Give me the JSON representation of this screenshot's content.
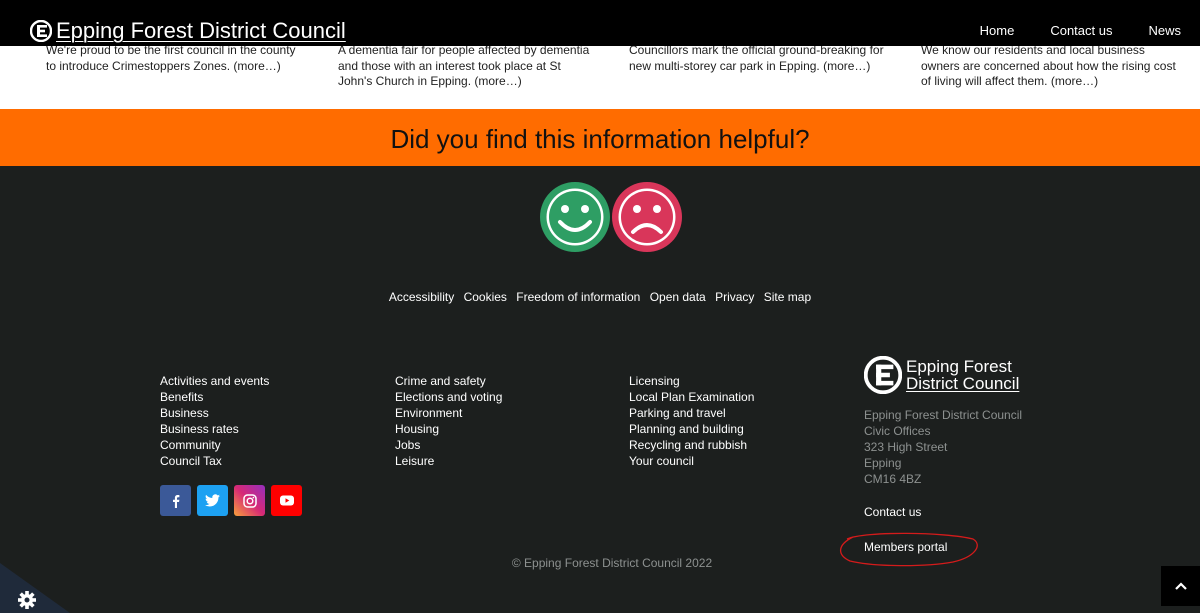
{
  "header": {
    "site_name": "Epping Forest District Council",
    "nav": [
      "Home",
      "Contact us",
      "News"
    ]
  },
  "news": [
    {
      "line0": "We're proud to be the first council in the county",
      "text": "to introduce Crimestoppers Zones. (more…)"
    },
    {
      "line0": "A dementia fair for people affected by dementia",
      "text": "and those with an interest took place at St",
      "text2": "John's Church in Epping. (more…)"
    },
    {
      "line0": "Councillors mark the official ground-breaking for",
      "text": "new multi-storey car park in Epping. (more…)"
    },
    {
      "line0": "We know our residents and local business",
      "text": "owners are concerned about how the rising cost",
      "text2": "of living will affect them. (more…)"
    }
  ],
  "feedback": {
    "question": "Did you find this information helpful?",
    "yes_color": "#2e9e64",
    "no_color": "#d9365a"
  },
  "footer_links": [
    "Accessibility",
    "Cookies",
    "Freedom of information",
    "Open data",
    "Privacy",
    "Site map"
  ],
  "columns": [
    [
      "Activities and events",
      "Benefits",
      "Business",
      "Business rates",
      "Community",
      "Council Tax"
    ],
    [
      "Crime and safety",
      "Elections and voting",
      "Environment",
      "Housing",
      "Jobs",
      "Leisure"
    ],
    [
      "Licensing",
      "Local Plan Examination",
      "Parking and travel",
      "Planning and building",
      "Recycling and rubbish",
      "Your council"
    ]
  ],
  "social": [
    {
      "name": "facebook",
      "glyph": "f",
      "color": "#3b5998"
    },
    {
      "name": "twitter",
      "glyph": "t",
      "color": "#1da1f2"
    },
    {
      "name": "instagram",
      "glyph": "◎",
      "color": "#c13584"
    },
    {
      "name": "youtube",
      "glyph": "▶",
      "color": "#ff0000"
    }
  ],
  "footer_logo": {
    "line1": "Epping Forest",
    "line2": "District Council"
  },
  "address": [
    "Epping Forest District Council",
    "Civic Offices",
    "323 High Street",
    "Epping",
    "CM16 4BZ"
  ],
  "contact_label": "Contact us",
  "members_label": "Members portal",
  "copyright": "© Epping Forest District Council 2022",
  "colors": {
    "orange": "#ff6c00",
    "footer_bg": "#1c1f1e",
    "annotation": "#d41b1b"
  }
}
